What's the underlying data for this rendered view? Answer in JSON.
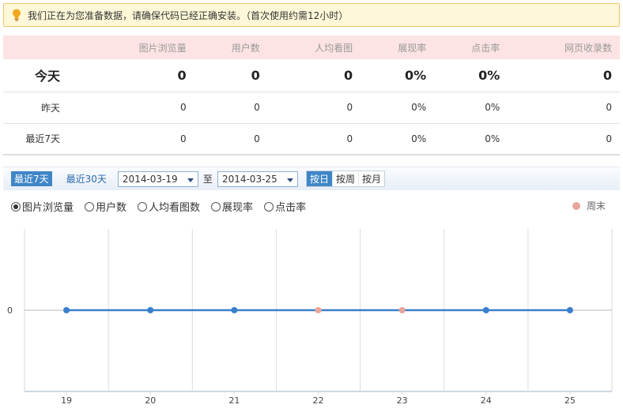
{
  "notice": {
    "text": "我们正在为您准备数据，请确保代码已经正确安装。（首次使用约需12小时）",
    "icon": "lightbulb-icon"
  },
  "stats": {
    "columns": [
      "图片浏览量",
      "用户数",
      "人均看图",
      "展现率",
      "点击率",
      "网页收录数"
    ],
    "rows": [
      {
        "label": "今天",
        "values": [
          "0",
          "0",
          "0",
          "0%",
          "0%",
          "0"
        ]
      },
      {
        "label": "昨天",
        "values": [
          "0",
          "0",
          "0",
          "0%",
          "0%",
          "0"
        ]
      },
      {
        "label": "最近7天",
        "values": [
          "0",
          "0",
          "0",
          "0%",
          "0%",
          "0"
        ]
      }
    ]
  },
  "toolbar": {
    "range_7": "最近7天",
    "range_30": "最近30天",
    "start_date": "2014-03-19",
    "to": "至",
    "end_date": "2014-03-25",
    "by_day": "按日",
    "by_week": "按周",
    "by_month": "按月"
  },
  "metrics": {
    "options": [
      "图片浏览量",
      "用户数",
      "人均看图数",
      "展现率",
      "点击率"
    ],
    "selected": "图片浏览量"
  },
  "legend": {
    "weekend": "周末",
    "weekend_color": "#e8a59a"
  },
  "colors": {
    "accent": "#3f86c7",
    "line": "#3a7fcb",
    "header_bg": "#fde3e3",
    "notice_bg": "#fff8d8"
  },
  "chart_data": {
    "type": "line",
    "categories": [
      "19",
      "20",
      "21",
      "22",
      "23",
      "24",
      "25"
    ],
    "values": [
      0,
      0,
      0,
      0,
      0,
      0,
      0
    ],
    "weekend": [
      false,
      false,
      false,
      true,
      true,
      false,
      false
    ],
    "y_tick_labels": [
      "0"
    ],
    "grid": true
  }
}
